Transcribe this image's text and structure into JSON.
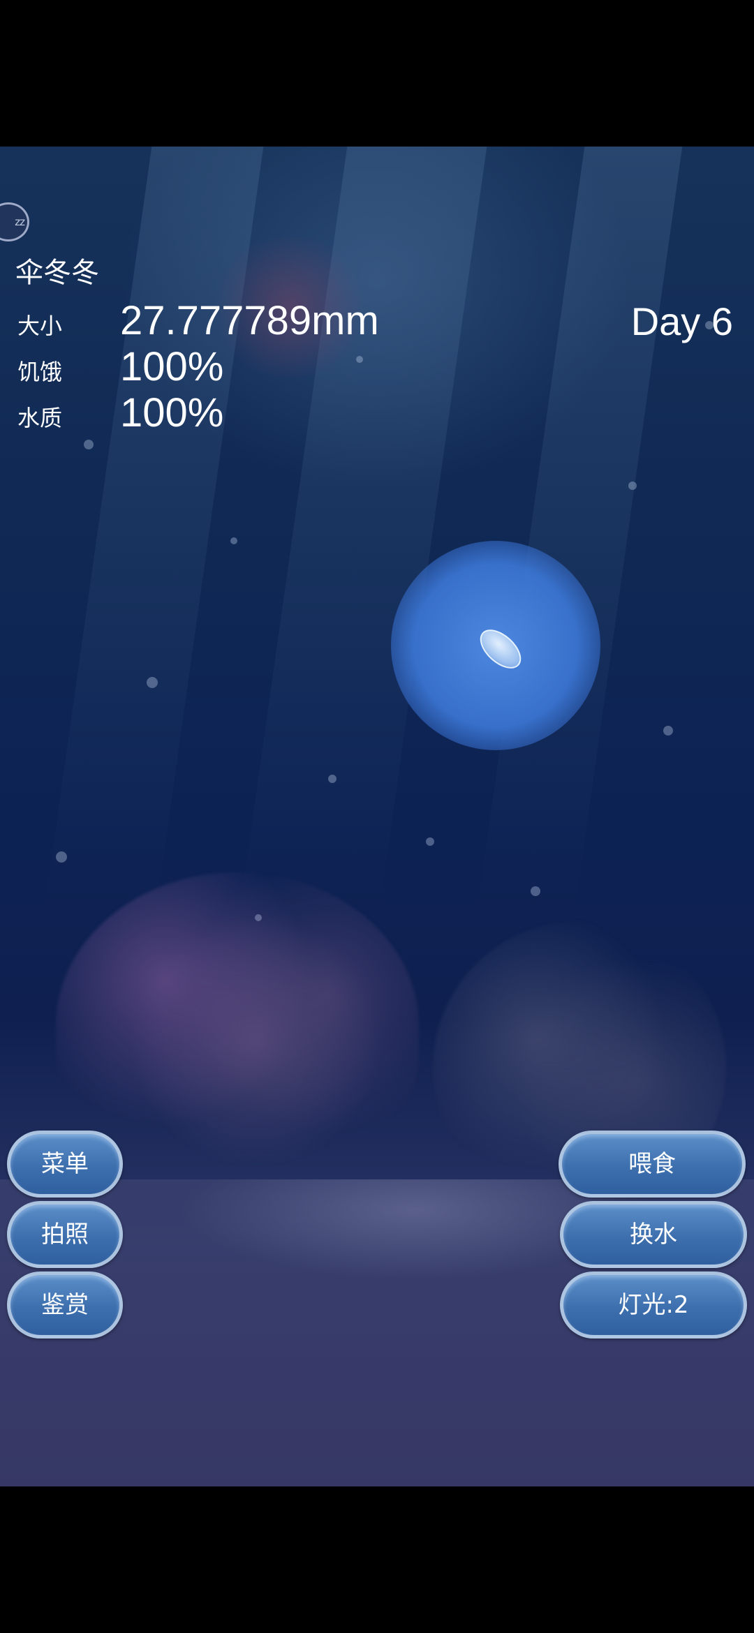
{
  "pet": {
    "name": "伞冬冬",
    "day": "Day 6"
  },
  "stats": {
    "size_label": "大小",
    "size_value": "27.777789mm",
    "hunger_label": "饥饿",
    "hunger_value": "100%",
    "water_label": "水质",
    "water_value": "100%"
  },
  "sleep_button": {
    "label": "zz"
  },
  "left_buttons": {
    "menu": "菜单",
    "photo": "拍照",
    "appreciate": "鉴赏"
  },
  "right_buttons": {
    "feed": "喂食",
    "change_water": "换水",
    "light": "灯光:2"
  },
  "colors": {
    "water_top": "#16325a",
    "water_mid": "#0c2253",
    "sand": "#30386a",
    "glow": "#4f8ae0",
    "button_fill": "#3d6fae",
    "button_border": "#b9cde6",
    "text": "#ffffff"
  }
}
